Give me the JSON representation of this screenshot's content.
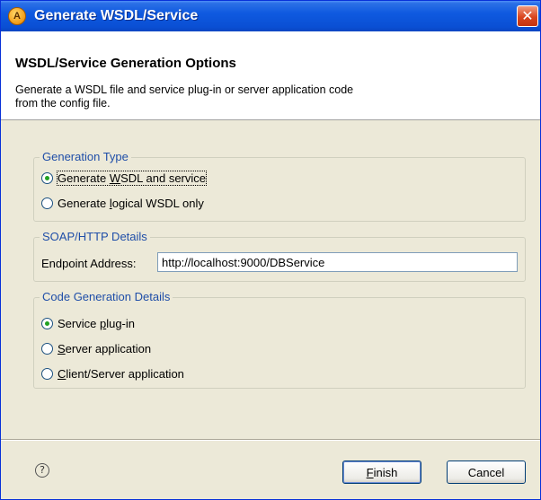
{
  "window": {
    "title": "Generate WSDL/Service",
    "app_icon_glyph": "A",
    "close_glyph": "✕"
  },
  "banner": {
    "title": "WSDL/Service Generation Options",
    "description_line1": "Generate a WSDL file and service plug-in or server application code",
    "description_line2": "from the config file."
  },
  "generation_type": {
    "legend": "Generation Type",
    "option1_pre": "Generate ",
    "option1_mn": "W",
    "option1_post": "SDL and service",
    "option1_checked": true,
    "option2_pre": "Generate ",
    "option2_mn": "l",
    "option2_post": "ogical WSDL only",
    "option2_checked": false
  },
  "soap_http": {
    "legend": "SOAP/HTTP Details",
    "endpoint_label": "Endpoint Address:",
    "endpoint_value": "http://localhost:9000/DBService"
  },
  "code_generation": {
    "legend": "Code Generation Details",
    "option1_pre": "Service ",
    "option1_mn": "p",
    "option1_post": "lug-in",
    "option1_checked": true,
    "option2_pre": "",
    "option2_mn": "S",
    "option2_post": "erver application",
    "option2_checked": false,
    "option3_pre": "",
    "option3_mn": "C",
    "option3_post": "lient/Server application",
    "option3_checked": false
  },
  "footer": {
    "help_glyph": "?",
    "finish_mn": "F",
    "finish_rest": "inish",
    "cancel_label": "Cancel"
  },
  "colors": {
    "titlebar": "#0a4fd4",
    "dialog_bg": "#ece9d8",
    "legend_text": "#1f4ea8",
    "radio_check": "#21a121"
  }
}
